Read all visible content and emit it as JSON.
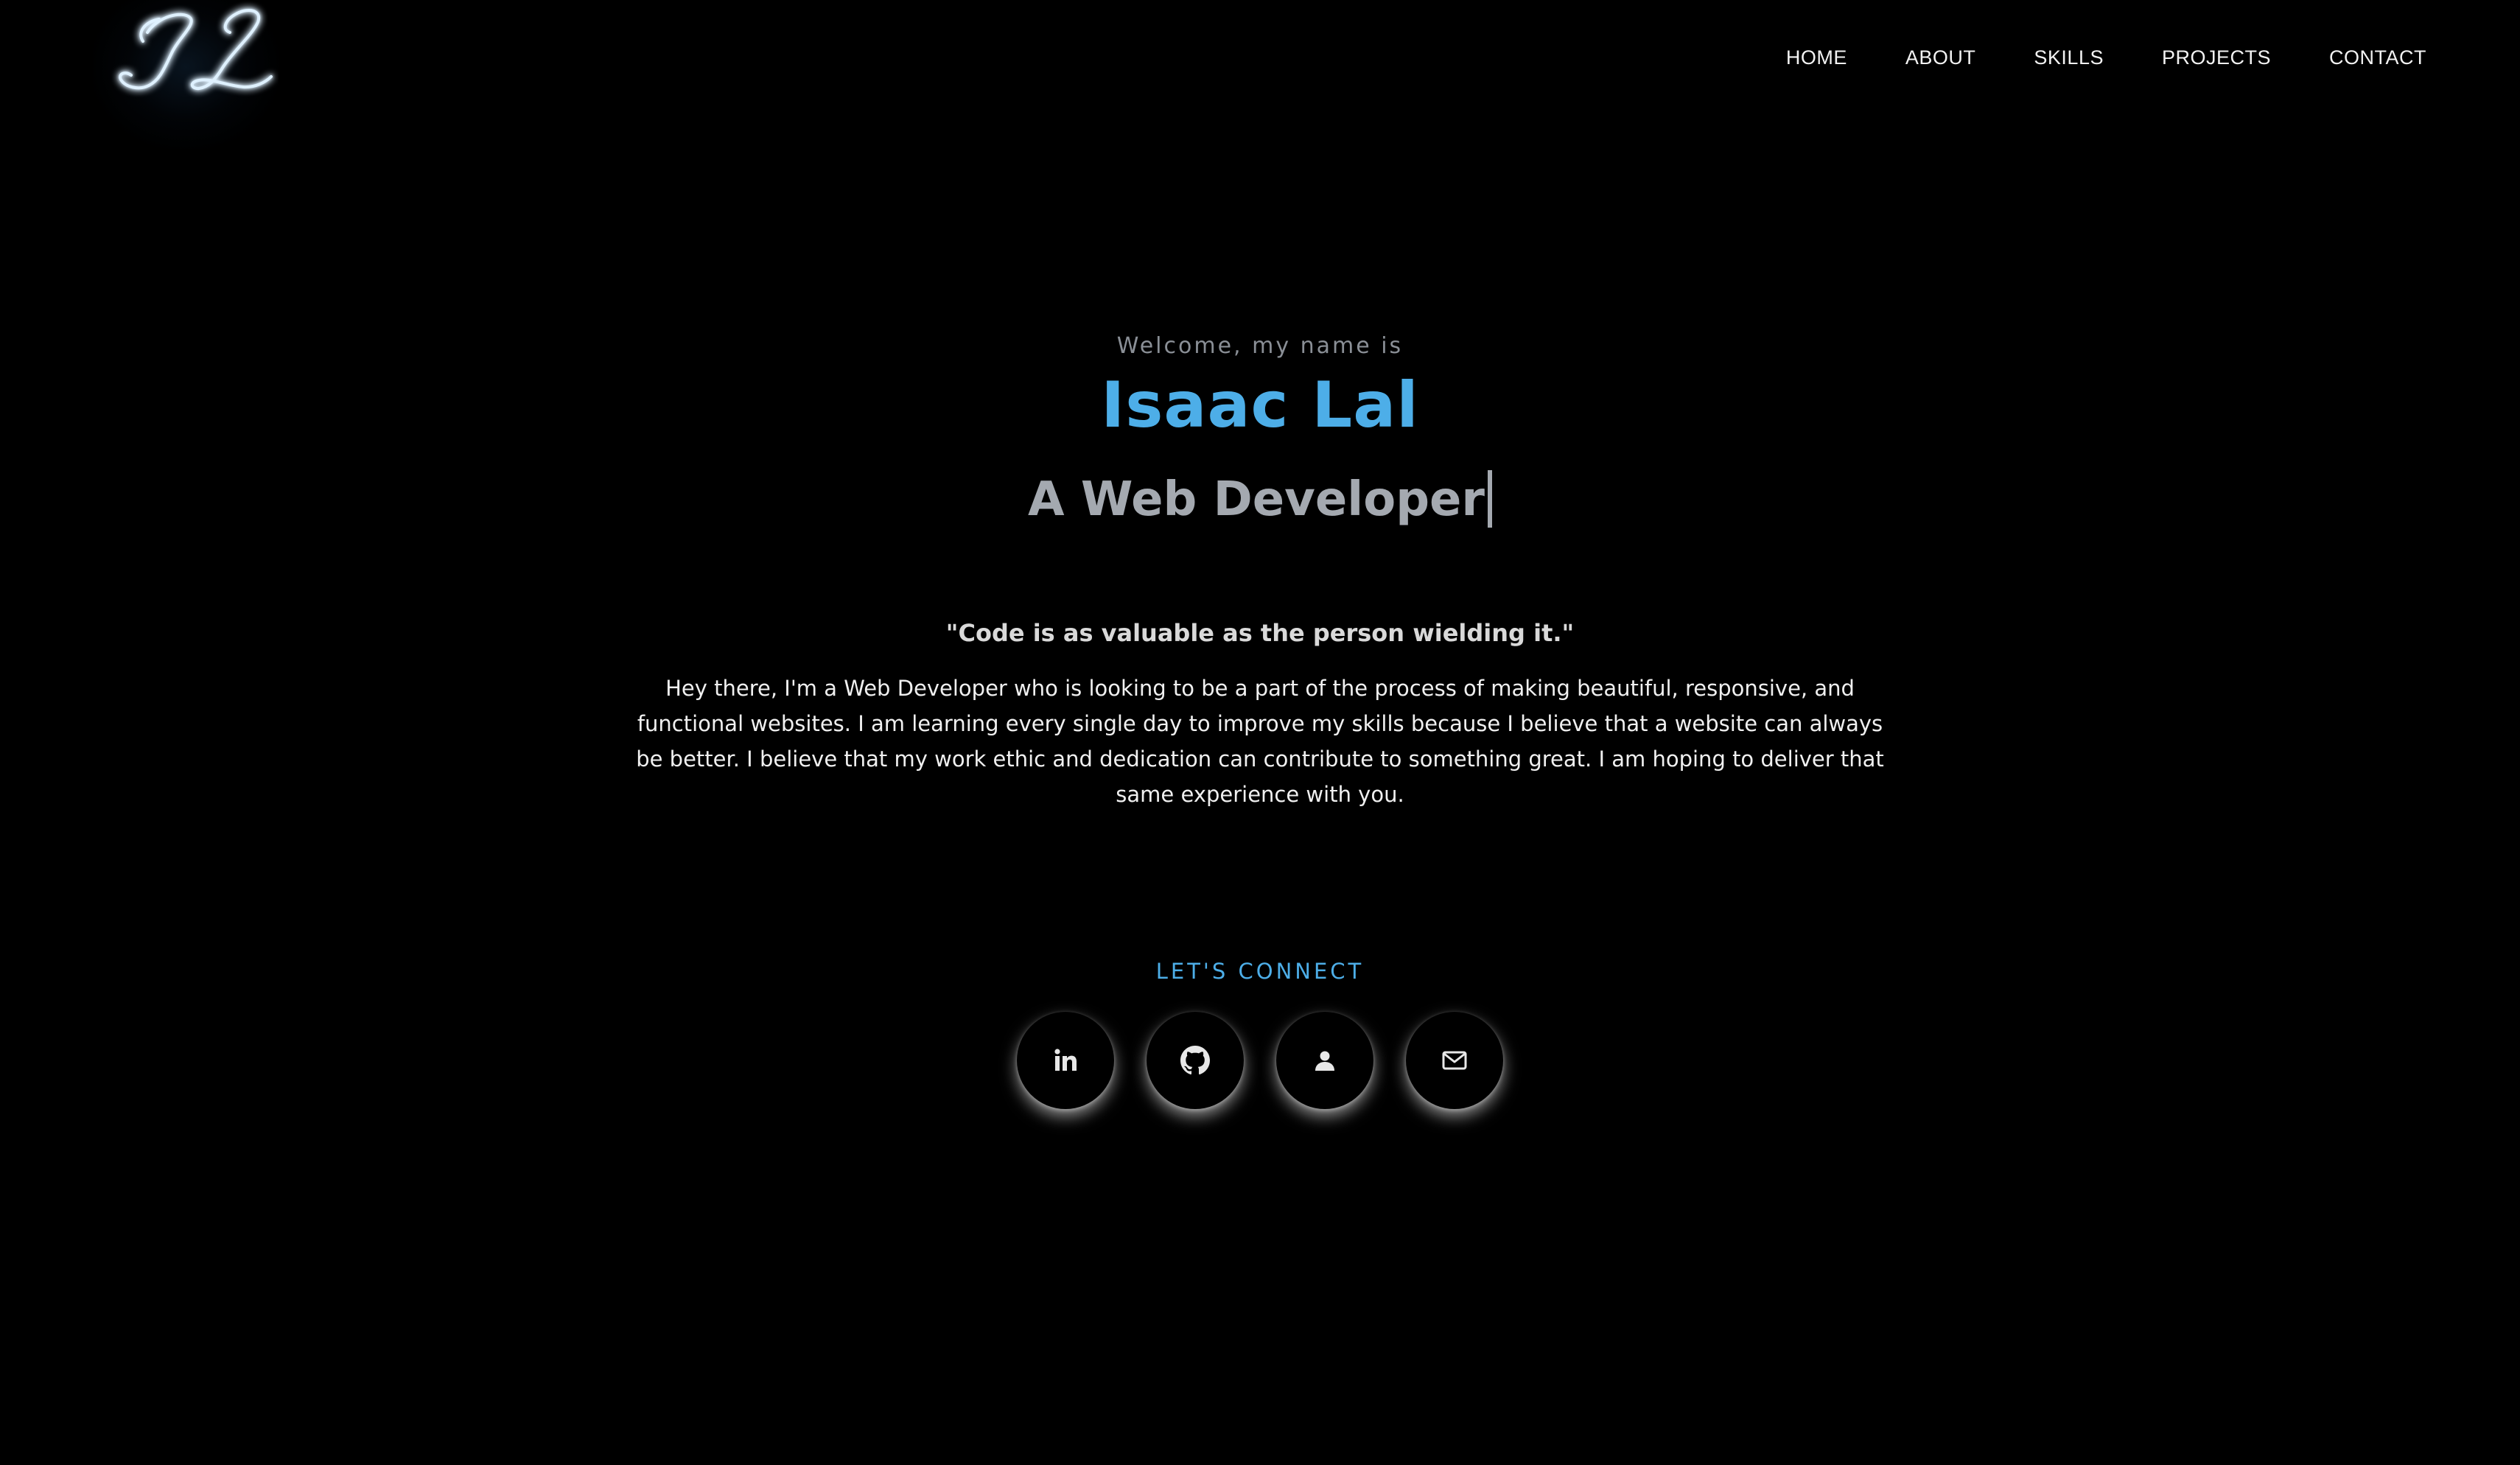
{
  "header": {
    "logo_text": "IL",
    "nav": [
      {
        "label": "HOME"
      },
      {
        "label": "ABOUT"
      },
      {
        "label": "SKILLS"
      },
      {
        "label": "PROJECTS"
      },
      {
        "label": "CONTACT"
      }
    ]
  },
  "hero": {
    "welcome": "Welcome, my name is",
    "name": "Isaac Lal",
    "role": "A Web Developer",
    "quote": "\"Code is as valuable as the person wielding it.\"",
    "bio": "Hey there, I'm a Web Developer who is looking to be a part of the process of making beautiful, responsive, and functional websites. I am learning every single day to improve my skills because I believe that a website can always be better. I believe that my work ethic and dedication can contribute to something great. I am hoping to deliver that same experience with you."
  },
  "connect": {
    "label": "LET'S CONNECT",
    "links": [
      {
        "icon": "linkedin-icon"
      },
      {
        "icon": "github-icon"
      },
      {
        "icon": "person-icon"
      },
      {
        "icon": "mail-icon"
      }
    ]
  },
  "colors": {
    "background": "#000000",
    "accent": "#4daee8",
    "role_text": "#a4a9b0",
    "welcome_text": "#8a8f96",
    "logo_glow": "#9fd6ff"
  }
}
